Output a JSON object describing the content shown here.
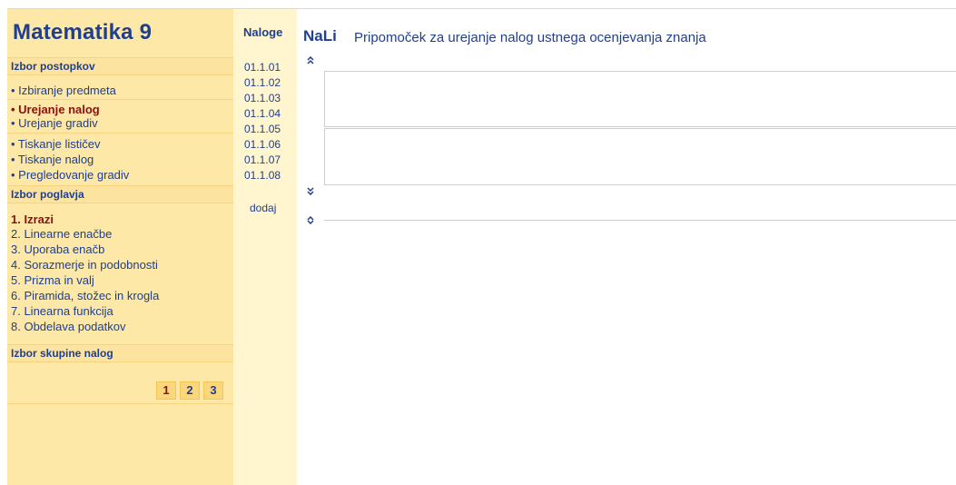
{
  "app_title": "Matematika 9",
  "sections": {
    "postopki": "Izbor postopkov",
    "poglavja": "Izbor poglavja",
    "skupine": "Izbor skupine nalog"
  },
  "postopki_items": [
    {
      "label": "• Izbiranje predmeta"
    },
    {
      "label": "• Urejanje nalog"
    },
    {
      "label": "• Urejanje gradiv"
    },
    {
      "label": "• Tiskanje lističev"
    },
    {
      "label": "• Tiskanje nalog"
    },
    {
      "label": "• Pregledovanje gradiv"
    }
  ],
  "poglavja_items": [
    {
      "label": "1. Izrazi"
    },
    {
      "label": "2. Linearne enačbe"
    },
    {
      "label": "3. Uporaba enačb"
    },
    {
      "label": "4. Sorazmerje in podobnosti"
    },
    {
      "label": "5. Prizma in valj"
    },
    {
      "label": "6. Piramida, stožec in krogla"
    },
    {
      "label": "7. Linearna funkcija"
    },
    {
      "label": "8. Obdelava podatkov"
    }
  ],
  "pages": [
    "1",
    "2",
    "3"
  ],
  "tasks": {
    "header": "Naloge",
    "items": [
      "01.1.01",
      "01.1.02",
      "01.1.03",
      "01.1.04",
      "01.1.05",
      "01.1.06",
      "01.1.07",
      "01.1.08"
    ],
    "add": "dodaj"
  },
  "main": {
    "brand": "NaLi",
    "description": "Pripomoček za urejanje nalog ustnega ocenjevanja znanja"
  },
  "icons": {
    "collapse_up": "double-chevron-up-icon",
    "collapse_down": "double-chevron-down-icon",
    "toggle": "up-down-chevron-icon"
  },
  "colors": {
    "sidebar_bg": "#fde8a8",
    "tasks_bg": "#fff5cf",
    "text_blue": "#1f3f8f",
    "active_red": "#8b1010"
  }
}
